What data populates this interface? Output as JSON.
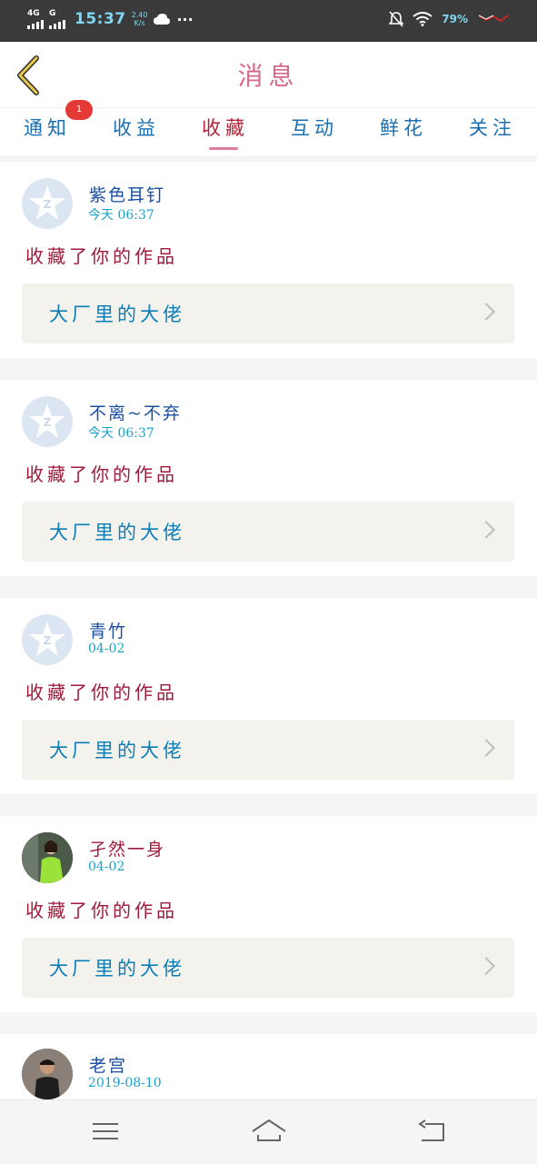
{
  "status_bar": {
    "network_1": "4G",
    "network_2": "G",
    "time": "15:37",
    "speed": "2.40",
    "speed_unit": "K/s",
    "more": "···",
    "battery": "79%"
  },
  "header": {
    "title": "消息"
  },
  "tabs": [
    {
      "label": "通知"
    },
    {
      "label": "收益"
    },
    {
      "label": "收藏"
    },
    {
      "label": "互动"
    },
    {
      "label": "鲜花"
    },
    {
      "label": "关注"
    }
  ],
  "active_tab": "收藏",
  "badge": "1",
  "messages": [
    {
      "name": "紫色耳钉",
      "time": "今天 06:37",
      "action": "收藏了你的作品",
      "work_title": "大厂里的大佬",
      "avatar": "default-qq-avatar"
    },
    {
      "name": "不离~不弃",
      "time": "今天 06:37",
      "action": "收藏了你的作品",
      "work_title": "大厂里的大佬",
      "avatar": "default-qq-avatar"
    },
    {
      "name": "青竹",
      "time": "04-02",
      "action": "收藏了你的作品",
      "work_title": "大厂里的大佬",
      "avatar": "default-qq-avatar"
    },
    {
      "name": "孑然一身",
      "time": "04-02",
      "action": "收藏了你的作品",
      "work_title": "大厂里的大佬",
      "avatar": "photo-woman-green"
    },
    {
      "name": "老宫",
      "time": "2019-08-10",
      "action": "",
      "work_title": "",
      "avatar": "photo-man"
    }
  ],
  "colors": {
    "accent": "#e07aa0",
    "badge": "#e53935",
    "status_bar": "#3a3a3a"
  }
}
